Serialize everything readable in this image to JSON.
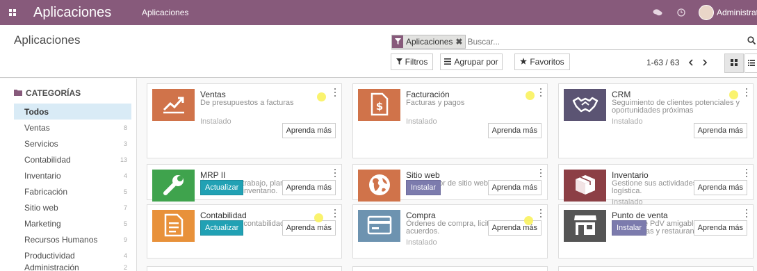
{
  "navbar": {
    "brand": "Aplicaciones",
    "menu_item": "Aplicaciones",
    "user": "Administrator",
    "icons": [
      "apps-grid-icon",
      "chat-icon",
      "clock-icon",
      "avatar"
    ]
  },
  "control_panel": {
    "title": "Aplicaciones",
    "facet_value": "Aplicaciones",
    "search_placeholder": "Buscar...",
    "filters_label": "Filtros",
    "groupby_label": "Agrupar por",
    "favorites_label": "Favoritos",
    "pager": "1-63 / 63"
  },
  "sidebar": {
    "header": "CATEGORÍAS",
    "items": [
      {
        "label": "Todos",
        "count": ""
      },
      {
        "label": "Ventas",
        "count": "8"
      },
      {
        "label": "Servicios",
        "count": "3"
      },
      {
        "label": "Contabilidad",
        "count": "13"
      },
      {
        "label": "Inventario",
        "count": "4"
      },
      {
        "label": "Fabricación",
        "count": "5"
      },
      {
        "label": "Sitio web",
        "count": "7"
      },
      {
        "label": "Marketing",
        "count": "5"
      },
      {
        "label": "Recursos Humanos",
        "count": "9"
      },
      {
        "label": "Productividad",
        "count": "4"
      },
      {
        "label": "Administración",
        "count": "2"
      }
    ]
  },
  "apps": [
    {
      "name": "Ventas",
      "desc": "De presupuestos a facturas",
      "status": "Instalado",
      "action": "",
      "learn": "Aprenda más",
      "tile_color": "#d0734a",
      "icon": "chart-up-icon"
    },
    {
      "name": "Facturación",
      "desc": "Facturas y pagos",
      "status": "Instalado",
      "action": "",
      "learn": "Aprenda más",
      "tile_color": "#d0734a",
      "icon": "invoice-icon"
    },
    {
      "name": "CRM",
      "desc": "Seguimiento de clientes potenciales y oportunidades próximas",
      "status": "Instalado",
      "action": "",
      "learn": "Aprenda más",
      "tile_color": "#5b5473",
      "icon": "handshake-icon"
    },
    {
      "name": "MRP II",
      "desc": "Órdenes de trabajo, planificación, informes de inventario.",
      "status": "",
      "action": "Actualizar",
      "learn": "Aprenda más",
      "tile_color": "#3fa34d",
      "icon": "wrench-icon"
    },
    {
      "name": "Sitio web",
      "desc": "Constructor de sitio web empresarial",
      "status": "",
      "action": "Instalar",
      "learn": "Aprenda más",
      "tile_color": "#d0734a",
      "icon": "globe-icon"
    },
    {
      "name": "Inventario",
      "desc": "Gestione sus actividades de stock y logística.",
      "status": "Instalado",
      "action": "",
      "learn": "Aprenda más",
      "tile_color": "#8c3f45",
      "icon": "box-icon"
    },
    {
      "name": "Contabilidad",
      "desc": "Gestionar la contabilidad financiera y analítica.",
      "status": "",
      "action": "Actualizar",
      "learn": "Aprenda más",
      "tile_color": "#e8913a",
      "icon": "document-icon"
    },
    {
      "name": "Compra",
      "desc": "Órdenes de compra, licitaciones y acuerdos.",
      "status": "Instalado",
      "action": "",
      "learn": "Aprenda más",
      "tile_color": "#6d93b0",
      "icon": "credit-card-icon"
    },
    {
      "name": "Punto de venta",
      "desc": "Interfaz de PdV amigable para usuarios para tiendas y restaurantes",
      "status": "",
      "action": "Instalar",
      "learn": "Aprenda más",
      "tile_color": "#555555",
      "icon": "shop-icon"
    }
  ]
}
